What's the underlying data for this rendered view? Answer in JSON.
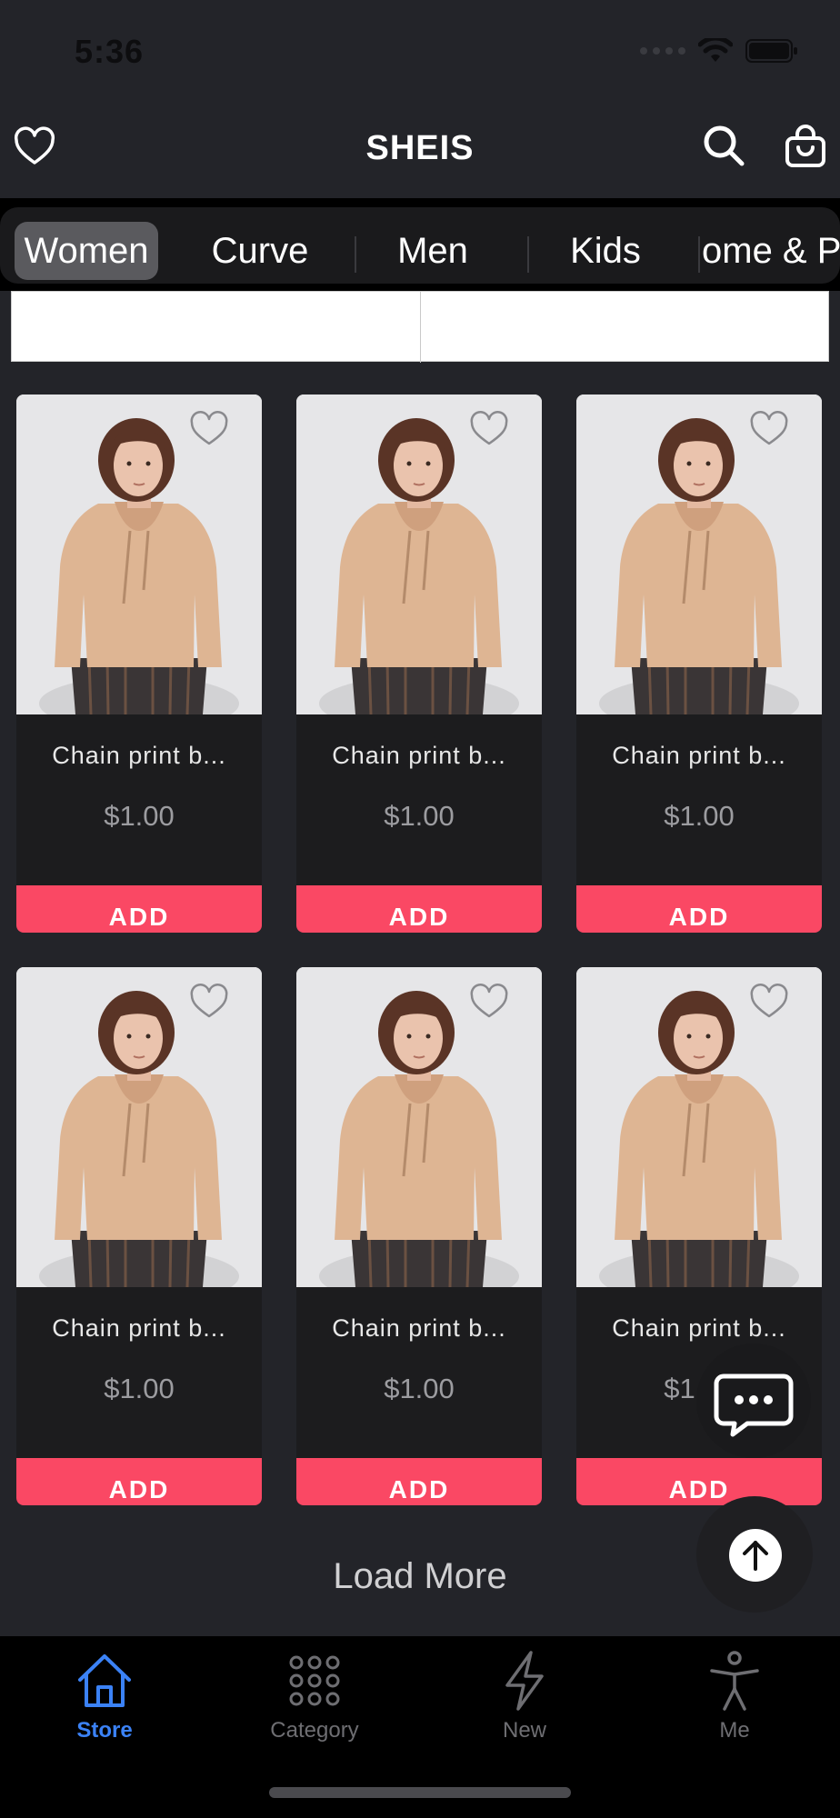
{
  "status": {
    "time": "5:36"
  },
  "header": {
    "title": "SHEIS"
  },
  "tabs": [
    {
      "label": "Women",
      "active": true
    },
    {
      "label": "Curve",
      "active": false
    },
    {
      "label": "Men",
      "active": false
    },
    {
      "label": "Kids",
      "active": false
    },
    {
      "label": "ome & Po",
      "active": false
    }
  ],
  "products": [
    {
      "name": "Chain print b...",
      "price": "$1.00",
      "add_label": "ADD"
    },
    {
      "name": "Chain print b...",
      "price": "$1.00",
      "add_label": "ADD"
    },
    {
      "name": "Chain print b...",
      "price": "$1.00",
      "add_label": "ADD"
    },
    {
      "name": "Chain print b...",
      "price": "$1.00",
      "add_label": "ADD"
    },
    {
      "name": "Chain print b...",
      "price": "$1.00",
      "add_label": "ADD"
    },
    {
      "name": "Chain print b...",
      "price": "$1.00",
      "add_label": "ADD"
    }
  ],
  "load_more": "Load More",
  "bottom_nav": [
    {
      "label": "Store",
      "icon": "home-icon",
      "active": true
    },
    {
      "label": "Category",
      "icon": "grid-dots-icon",
      "active": false
    },
    {
      "label": "New",
      "icon": "lightning-icon",
      "active": false
    },
    {
      "label": "Me",
      "icon": "accessibility-person-icon",
      "active": false
    }
  ],
  "colors": {
    "background": "#232429",
    "accent_add": "#fa4864",
    "nav_active": "#3b82f6"
  }
}
